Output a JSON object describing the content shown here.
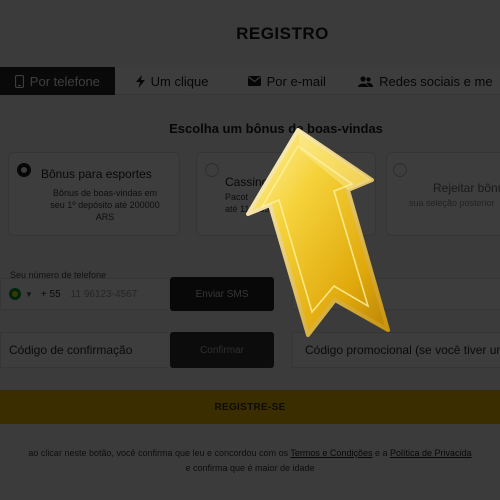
{
  "header": {
    "title": "REGISTRO"
  },
  "tabs": [
    {
      "label": "Por telefone",
      "icon": "phone-icon",
      "active": true
    },
    {
      "label": "Um clique",
      "icon": "bolt-icon",
      "active": false
    },
    {
      "label": "Por e-mail",
      "icon": "envelope-icon",
      "active": false
    },
    {
      "label": "Redes sociais e me",
      "icon": "users-icon",
      "active": false
    }
  ],
  "bonus": {
    "heading": "Escolha um bônus de boas-vindas",
    "options": [
      {
        "title": "Bônus para esportes",
        "lines": [
          "Bônus de boas-vindas em",
          "seu 1º depósito até 200000",
          "ARS"
        ],
        "selected": true
      },
      {
        "title": "Cassino",
        "lines": [
          "Pacot",
          "até 1109850"
        ],
        "selected": false
      },
      {
        "title": "Rejeitar bônu",
        "lines": [
          "sua seleção posterior"
        ],
        "selected": false
      }
    ]
  },
  "form": {
    "phone_label": "Seu número de telefone",
    "phone_code": "+ 55",
    "phone_placeholder": "11 96123-4567",
    "send_sms": "Enviar SMS",
    "currency_label": "eda",
    "currency_value": "(ARS)",
    "code_label": "Código de confirmação",
    "confirm": "Confirmar",
    "promo_label": "Código promocional (se você tiver um"
  },
  "register": {
    "label": "REGISTRE-SE"
  },
  "terms": {
    "before": "ao clicar neste botão, você confirma que leu e concordou com os",
    "terms_link": "Termos e Condições",
    "middle": "e a",
    "privacy_link": "Política de Privacida",
    "line2": "e confirma que é maior de idade"
  },
  "colors": {
    "accent": "#f2c200",
    "arrow_gold": "#f0c419",
    "overlay": "#000000",
    "active_tab": "#262626"
  }
}
